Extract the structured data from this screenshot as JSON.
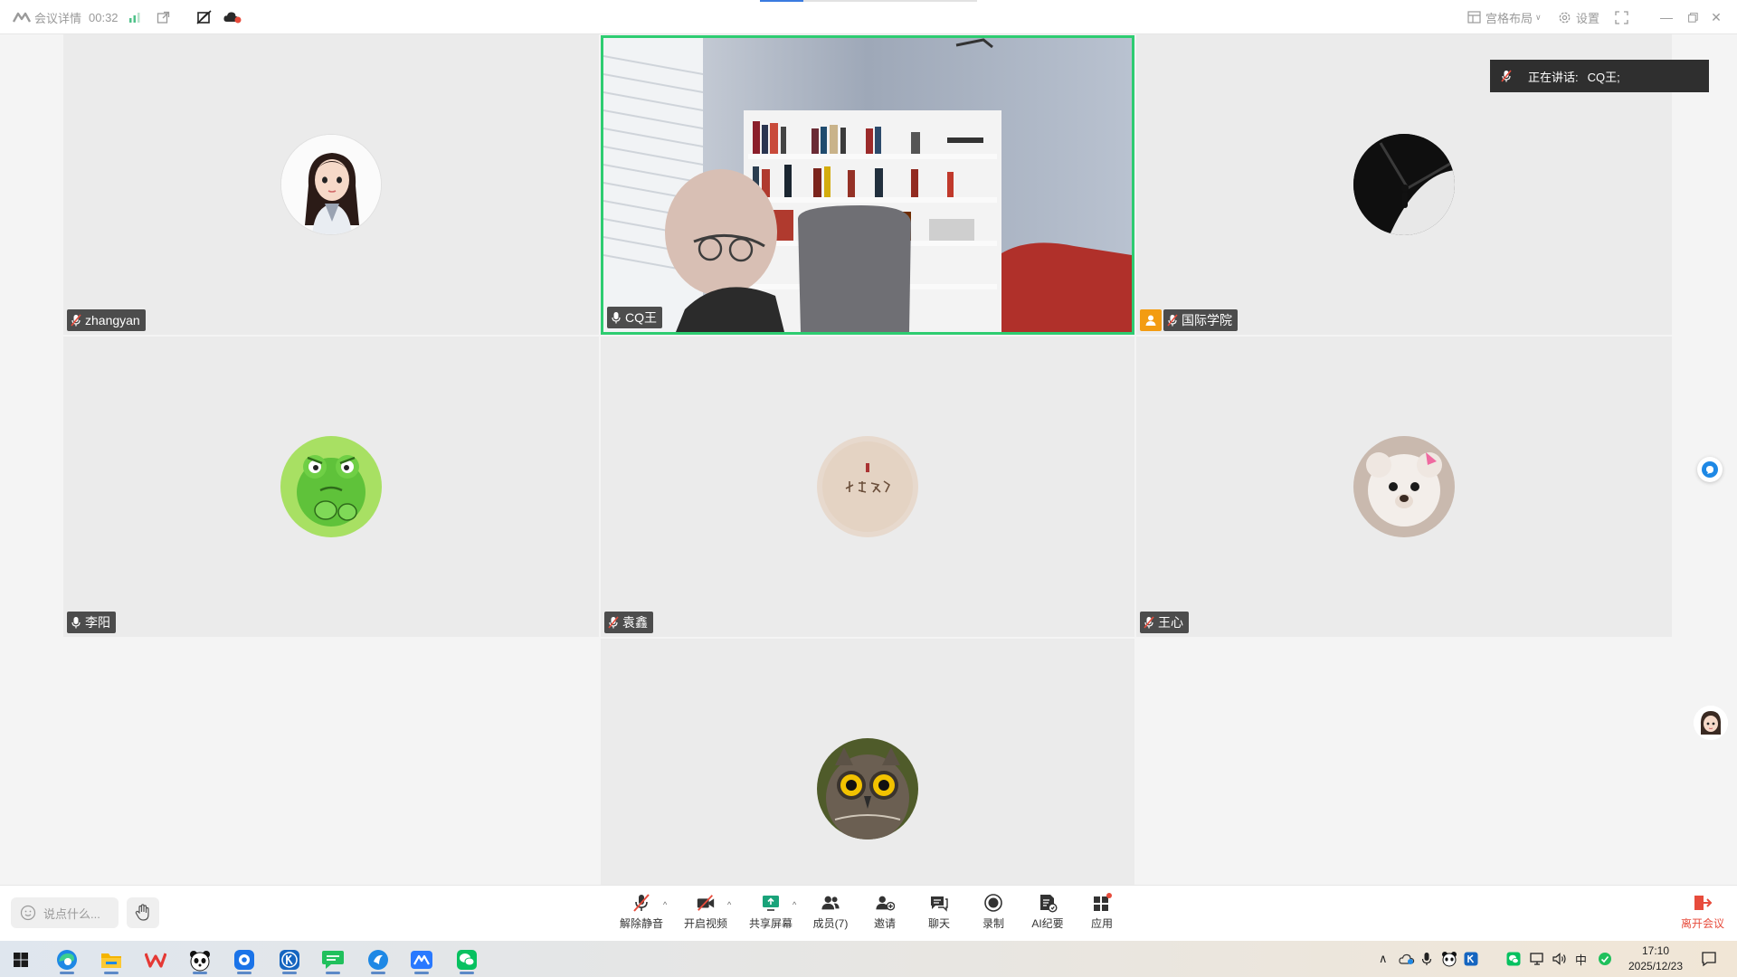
{
  "titlebar": {
    "meeting_info_label": "会议详情",
    "timer": "00:32",
    "layout_label": "宫格布局",
    "settings_label": "设置",
    "top_progress_fraction": 0.2
  },
  "participants": [
    {
      "name": "zhangyan",
      "muted": true
    },
    {
      "name": "CQ王",
      "muted": false,
      "video_on": true
    },
    {
      "name": "国际学院",
      "muted": true,
      "host_badge": true
    },
    {
      "name": "李阳",
      "muted": false
    },
    {
      "name": "袁鑫",
      "muted": true
    },
    {
      "name": "王心",
      "muted": true
    },
    {
      "name": "",
      "muted": false
    }
  ],
  "speaking": {
    "label": "正在讲话:",
    "name": "CQ王;"
  },
  "toolbar": {
    "chat_placeholder": "说点什么...",
    "unmute": "解除静音",
    "start_video": "开启视频",
    "share_screen": "共享屏幕",
    "members": "成员(7)",
    "invite": "邀请",
    "chat": "聊天",
    "record": "录制",
    "ai_minutes": "AI纪要",
    "apps": "应用",
    "leave": "离开会议"
  },
  "taskbar": {
    "ime": "中",
    "time": "17:10",
    "date": "2025/12/23"
  },
  "colors": {
    "active_border": "#2ecc71",
    "leave_red": "#e74c3c",
    "host_orange": "#f39c12",
    "accent_blue": "#3a7be0"
  }
}
